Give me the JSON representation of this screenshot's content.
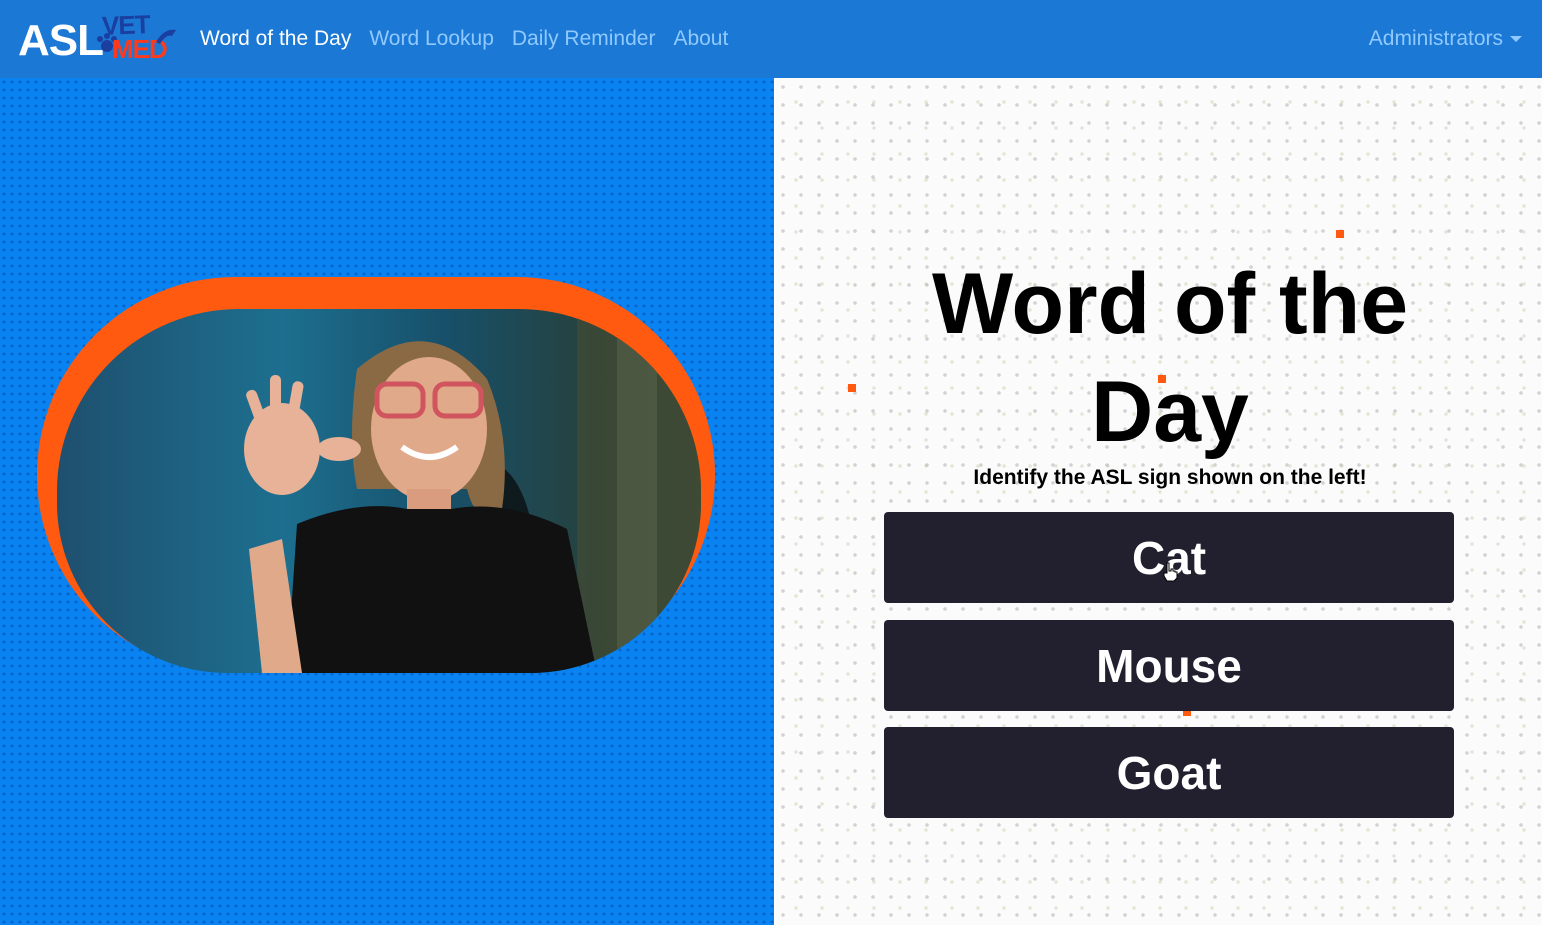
{
  "brand": {
    "asl": "ASL",
    "vet": "VET",
    "med": "MED"
  },
  "nav": {
    "items": [
      {
        "label": "Word of the Day",
        "active": true
      },
      {
        "label": "Word Lookup",
        "active": false
      },
      {
        "label": "Daily Reminder",
        "active": false
      },
      {
        "label": "About",
        "active": false
      }
    ],
    "admin_label": "Administrators"
  },
  "video": {
    "icon": "signer-video"
  },
  "quiz": {
    "title": "Word of the Day",
    "subtitle": "Identify the ASL sign shown on the left!",
    "answers": [
      "Cat",
      "Mouse",
      "Goat"
    ]
  },
  "colors": {
    "navbar": "#1b78d4",
    "left_panel": "#0a83f2",
    "frame": "#ff5a0f",
    "button": "#22202e",
    "nav_link": "#8fc9ff"
  }
}
